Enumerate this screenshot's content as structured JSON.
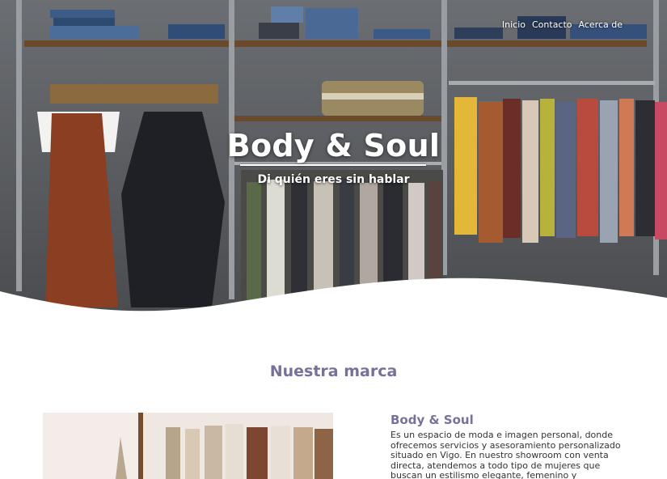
{
  "nav": {
    "items": [
      {
        "label": "Inicio"
      },
      {
        "label": "Contacto"
      },
      {
        "label": "Acerca de"
      }
    ]
  },
  "hero": {
    "title": "Body & Soul",
    "subtitle": "Di quién eres sin hablar"
  },
  "brand_section": {
    "title": "Nuestra marca",
    "heading": "Body & Soul",
    "text": "Es un espacio de moda e imagen personal, donde ofrecemos servicios y asesoramiento personalizado situado en Vigo. En nuestro showroom con venta directa, atendemos a todo tipo de mujeres que buscan un estilismo elegante, femenino y diferenciador para el día a"
  },
  "colors": {
    "accent": "#77719a",
    "text": "#333333",
    "background": "#ffffff"
  }
}
